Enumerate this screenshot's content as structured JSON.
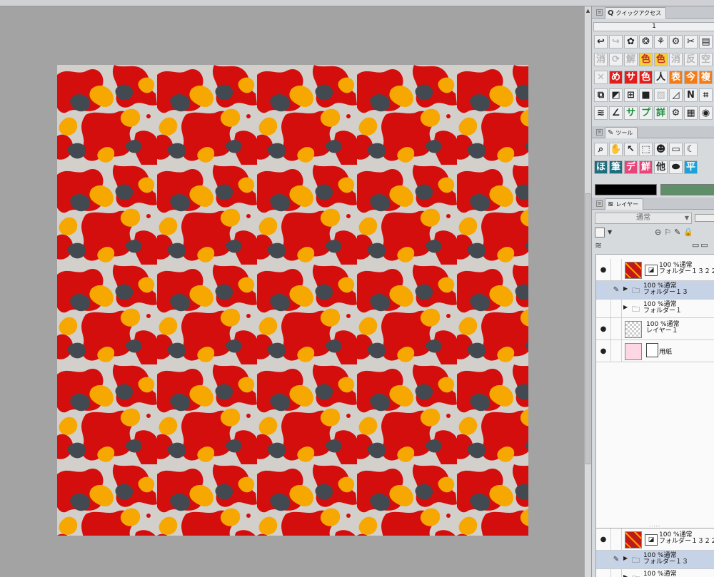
{
  "quick_access": {
    "tab_label": "クイックアクセス",
    "set_value": "1",
    "rows": [
      [
        {
          "glyph": "↩",
          "style": ""
        },
        {
          "glyph": "↪",
          "style": "dim"
        },
        {
          "glyph": "✿",
          "style": ""
        },
        {
          "glyph": "❂",
          "style": ""
        },
        {
          "glyph": "⚘",
          "style": ""
        },
        {
          "glyph": "⚙",
          "style": ""
        },
        {
          "glyph": "✂",
          "style": ""
        },
        {
          "glyph": "▤",
          "style": ""
        }
      ],
      [
        {
          "glyph": "消",
          "style": "dim"
        },
        {
          "glyph": "⟳",
          "style": "dim"
        },
        {
          "glyph": "解",
          "style": "dim"
        },
        {
          "glyph": "色",
          "style": "yellow"
        },
        {
          "glyph": "色",
          "style": "yellow"
        },
        {
          "glyph": "消",
          "style": "dim"
        },
        {
          "glyph": "反",
          "style": "dim"
        },
        {
          "glyph": "空",
          "style": "dim"
        }
      ],
      [
        {
          "glyph": "✕",
          "style": "dim"
        },
        {
          "glyph": "め",
          "style": "red"
        },
        {
          "glyph": "サ",
          "style": "red"
        },
        {
          "glyph": "色",
          "style": "red"
        },
        {
          "glyph": "人",
          "style": ""
        },
        {
          "glyph": "表",
          "style": "orange"
        },
        {
          "glyph": "今",
          "style": "orange"
        },
        {
          "glyph": "複",
          "style": "orange"
        }
      ],
      [
        {
          "glyph": "⧉",
          "style": ""
        },
        {
          "glyph": "◩",
          "style": ""
        },
        {
          "glyph": "⊞",
          "style": ""
        },
        {
          "glyph": "■",
          "style": ""
        },
        {
          "glyph": "▨",
          "style": "dim"
        },
        {
          "glyph": "◿",
          "style": ""
        },
        {
          "glyph": "N",
          "style": ""
        },
        {
          "glyph": "⌗",
          "style": ""
        }
      ],
      [
        {
          "glyph": "≋",
          "style": ""
        },
        {
          "glyph": "∠",
          "style": ""
        },
        {
          "glyph": "サ",
          "style": "green"
        },
        {
          "glyph": "プ",
          "style": "green"
        },
        {
          "glyph": "詳",
          "style": "green"
        },
        {
          "glyph": "⚙",
          "style": ""
        },
        {
          "glyph": "▦",
          "style": ""
        },
        {
          "glyph": "◉",
          "style": ""
        }
      ]
    ]
  },
  "tool_panel": {
    "tab_label": "ツール",
    "rows": [
      [
        {
          "glyph": "⌕",
          "style": ""
        },
        {
          "glyph": "✋",
          "style": ""
        },
        {
          "glyph": "↖",
          "style": ""
        },
        {
          "glyph": "⬚",
          "style": ""
        },
        {
          "glyph": "☻",
          "style": ""
        },
        {
          "glyph": "▭",
          "style": ""
        },
        {
          "glyph": "☾",
          "style": ""
        }
      ],
      [
        {
          "glyph": "ほ",
          "style": "teal"
        },
        {
          "glyph": "筆",
          "style": "teal"
        },
        {
          "glyph": "デ",
          "style": "pink"
        },
        {
          "glyph": "鮮",
          "style": "pink"
        },
        {
          "glyph": "他",
          "style": ""
        },
        {
          "glyph": "⬬",
          "style": ""
        },
        {
          "glyph": "平",
          "style": "cyan"
        }
      ]
    ],
    "main_color": "#000000",
    "sub_color": "#5e8f68"
  },
  "layer_panel": {
    "tab_label": "レイヤー",
    "blend_mode": "通常",
    "layers": [
      {
        "line1": "100 %通常",
        "line2": "フォルダー１３２２",
        "thumb": "red",
        "has_mask": true,
        "visible": true,
        "folder": false,
        "selected": false,
        "pen": false
      },
      {
        "line1": "100 %通常",
        "line2": "フォルダー１３",
        "thumb": "",
        "has_mask": false,
        "visible": false,
        "folder": true,
        "selected": true,
        "pen": true
      },
      {
        "line1": "100 %通常",
        "line2": "フォルダー１",
        "thumb": "",
        "has_mask": false,
        "visible": false,
        "folder": true,
        "selected": false,
        "pen": false
      },
      {
        "line1": "100 %通常",
        "line2": "レイヤー１",
        "thumb": "check",
        "has_mask": false,
        "visible": true,
        "folder": false,
        "selected": false,
        "pen": false
      },
      {
        "line1": "",
        "line2": "用紙",
        "thumb": "pink",
        "has_mask": false,
        "visible": true,
        "folder": false,
        "selected": false,
        "pen": false,
        "paper": true
      }
    ],
    "dup_layers": [
      {
        "line1": "100 %通常",
        "line2": "フォルダー１３２２",
        "thumb": "red",
        "has_mask": true,
        "visible": true,
        "folder": false,
        "selected": false,
        "pen": false
      },
      {
        "line1": "100 %通常",
        "line2": "フォルダー１３",
        "thumb": "",
        "has_mask": false,
        "visible": false,
        "folder": true,
        "selected": true,
        "pen": true
      },
      {
        "line1": "100 %通常",
        "line2": "",
        "thumb": "",
        "has_mask": false,
        "visible": false,
        "folder": true,
        "selected": false,
        "pen": false
      }
    ]
  },
  "colors": {
    "red": "#d40d0d",
    "yellow": "#f7a800",
    "slate": "#424950",
    "bg": "#d3d0cb"
  }
}
